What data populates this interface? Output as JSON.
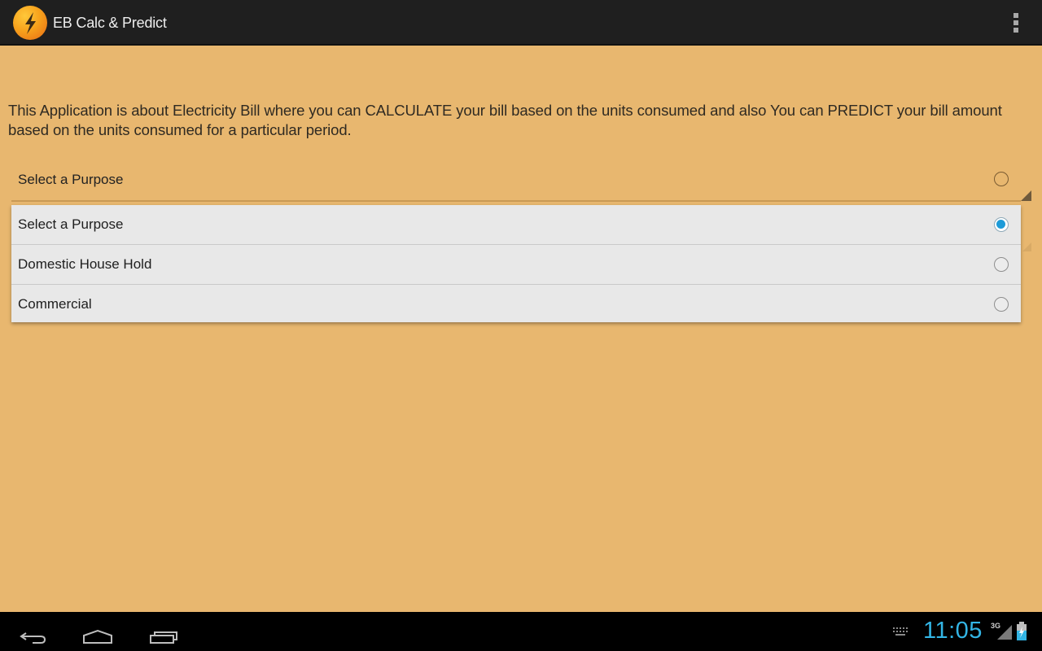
{
  "action_bar": {
    "app_icon": "lightning-bolt-icon",
    "title": "EB Calc & Predict",
    "overflow_icon": "overflow-menu-icon"
  },
  "main": {
    "description": "This Application is about Electricity Bill where you can CALCULATE your bill based on the units consumed and also You can PREDICT your bill amount based on the units consumed for a particular period.",
    "purpose_spinner": {
      "selected_label": "Select a Purpose",
      "options": [
        {
          "label": "Select a Purpose",
          "checked": true
        },
        {
          "label": "Domestic House Hold",
          "checked": false
        },
        {
          "label": "Commercial",
          "checked": false
        }
      ]
    }
  },
  "system_bar": {
    "back_icon": "back-icon",
    "home_icon": "home-icon",
    "recents_icon": "recent-apps-icon",
    "keyboard_icon": "keyboard-icon",
    "time": "11:05",
    "network_type": "3G",
    "signal_icon": "signal-icon",
    "battery_icon": "battery-charging-icon"
  },
  "colors": {
    "background": "#e8b76f",
    "action_bar": "#1f1f1f",
    "accent": "#33b5e5",
    "radio_checked": "#1d9bd8"
  }
}
